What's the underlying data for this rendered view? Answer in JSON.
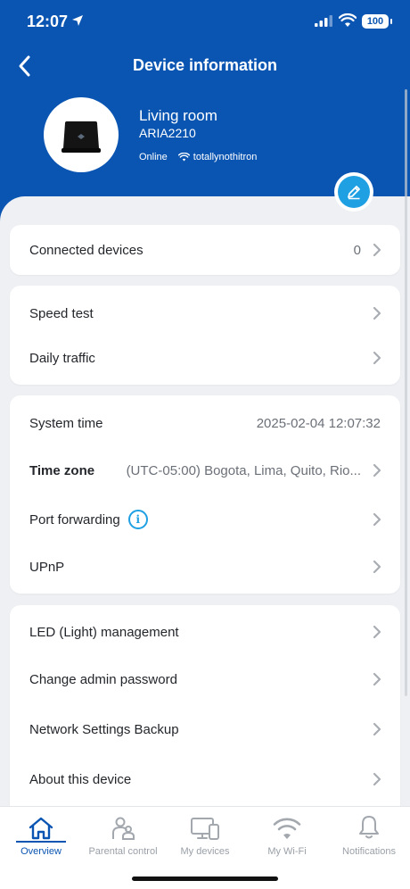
{
  "status_bar": {
    "time": "12:07",
    "battery": "100"
  },
  "nav": {
    "title": "Device information"
  },
  "device": {
    "name": "Living room",
    "model": "ARIA2210",
    "status": "Online",
    "ssid": "totallynothitron"
  },
  "sections": {
    "connected": {
      "label": "Connected devices",
      "count": "0"
    },
    "speed_test": {
      "label": "Speed test"
    },
    "daily_traffic": {
      "label": "Daily traffic"
    },
    "system_time": {
      "label": "System time",
      "value": "2025-02-04 12:07:32"
    },
    "time_zone": {
      "label": "Time zone",
      "value": "(UTC-05:00) Bogota, Lima, Quito, Rio..."
    },
    "port_forwarding": {
      "label": "Port forwarding"
    },
    "upnp": {
      "label": "UPnP"
    },
    "led": {
      "label": "LED (Light) management"
    },
    "admin_password": {
      "label": "Change admin password"
    },
    "backup": {
      "label": "Network Settings Backup"
    },
    "about": {
      "label": "About this device"
    }
  },
  "tabs": [
    {
      "label": "Overview",
      "icon": "home-icon",
      "active": true
    },
    {
      "label": "Parental control",
      "icon": "parental-icon",
      "active": false
    },
    {
      "label": "My devices",
      "icon": "devices-icon",
      "active": false
    },
    {
      "label": "My Wi-Fi",
      "icon": "wifi-icon",
      "active": false
    },
    {
      "label": "Notifications",
      "icon": "bell-icon",
      "active": false
    }
  ],
  "colors": {
    "header": "#0a55b2",
    "accent": "#1ea0e3",
    "background": "#eef0f3"
  }
}
